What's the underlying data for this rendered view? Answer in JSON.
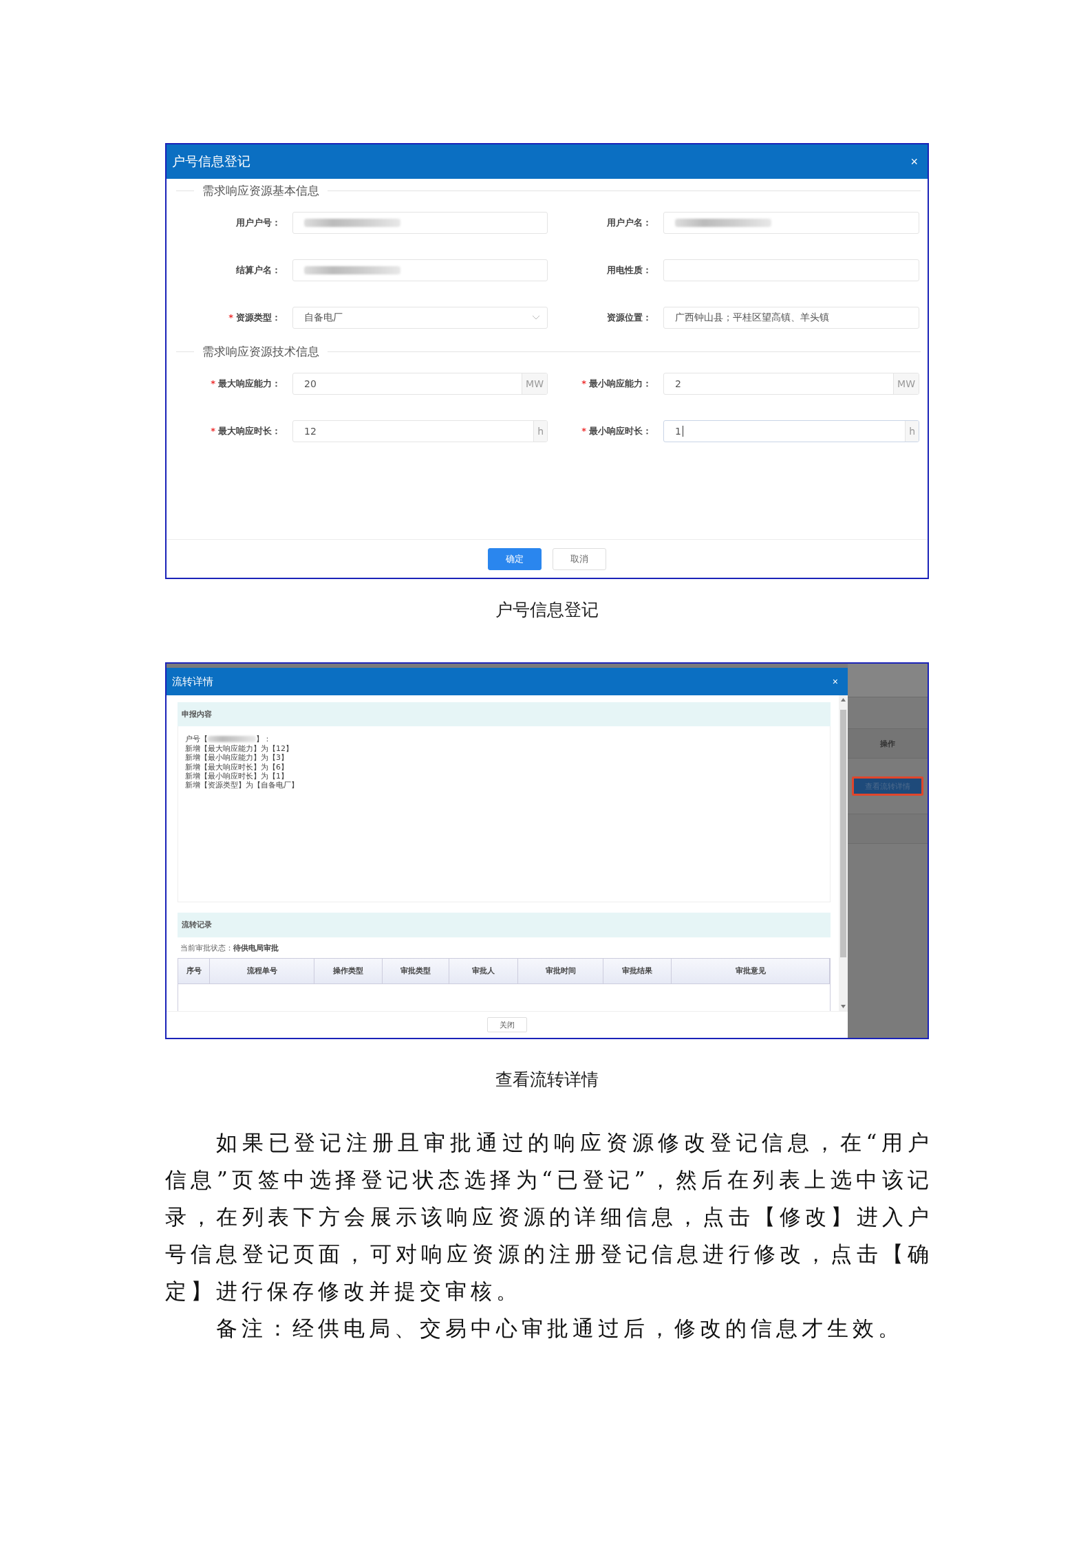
{
  "dialog1": {
    "title": "户号信息登记",
    "close": "×",
    "required_mark": "*",
    "sections": [
      {
        "heading": "需求响应资源基本信息",
        "fields": [
          {
            "label": "用户户号：",
            "required": false,
            "kind": "redacted"
          },
          {
            "label": "用户户名：",
            "required": false,
            "kind": "redacted"
          },
          {
            "label": "结算户名：",
            "required": false,
            "kind": "redacted"
          },
          {
            "label": "用电性质：",
            "required": false,
            "kind": "empty"
          },
          {
            "label": "资源类型：",
            "required": true,
            "kind": "select",
            "value": "自备电厂"
          },
          {
            "label": "资源位置：",
            "required": false,
            "kind": "text",
            "value": "广西钟山县；平桂区望高镇、羊头镇"
          }
        ]
      },
      {
        "heading": "需求响应资源技术信息",
        "fields": [
          {
            "label": "最大响应能力：",
            "required": true,
            "kind": "unit",
            "value": "20",
            "unit": "MW",
            "focused": false
          },
          {
            "label": "最小响应能力：",
            "required": true,
            "kind": "unit",
            "value": "2",
            "unit": "MW",
            "focused": false
          },
          {
            "label": "最大响应时长：",
            "required": true,
            "kind": "unit",
            "value": "12",
            "unit": "h",
            "focused": false
          },
          {
            "label": "最小响应时长：",
            "required": true,
            "kind": "unit",
            "value": "1",
            "unit": "h",
            "focused": true
          }
        ]
      }
    ],
    "buttons": [
      {
        "label": "确定",
        "primary": true
      },
      {
        "label": "取消",
        "primary": false
      }
    ]
  },
  "caption1": "户号信息登记",
  "dialog2": {
    "title": "流转详情",
    "close": "×",
    "content_section": {
      "heading": "申报内容",
      "first_line": {
        "prefix": "户号【",
        "suffix": "】："
      },
      "lines": [
        "新增【最大响应能力】为【12】",
        "新增【最小响应能力】为【3】",
        "新增【最大响应时长】为【6】",
        "新增【最小响应时长】为【1】",
        "新增【资源类型】为【自备电厂】"
      ]
    },
    "record_section": {
      "heading": "流转记录",
      "status_label": "当前审批状态：",
      "status_value": "待供电局审批",
      "columns": [
        "序号",
        "流程单号",
        "操作类型",
        "审批类型",
        "审批人",
        "审批时间",
        "审批结果",
        "审批意见"
      ]
    },
    "close_button": "关闭",
    "background": {
      "column_header": "操作",
      "button": "查看流转详情",
      "highlighted": true
    }
  },
  "caption2": "查看流转详情",
  "paragraphs": [
    "如果已登记注册且审批通过的响应资源修改登记信息，在“用户信息”页签中选择登记状态选择为“已登记”，然后在列表上选中该记录，在列表下方会展示该响应资源的详细信息，点击【修改】进入户号信息登记页面，可对响应资源的注册登记信息进行修改，点击【确定】进行保存修改并提交审核。",
    "备注：经供电局、交易中心审批通过后，修改的信息才生效。"
  ]
}
